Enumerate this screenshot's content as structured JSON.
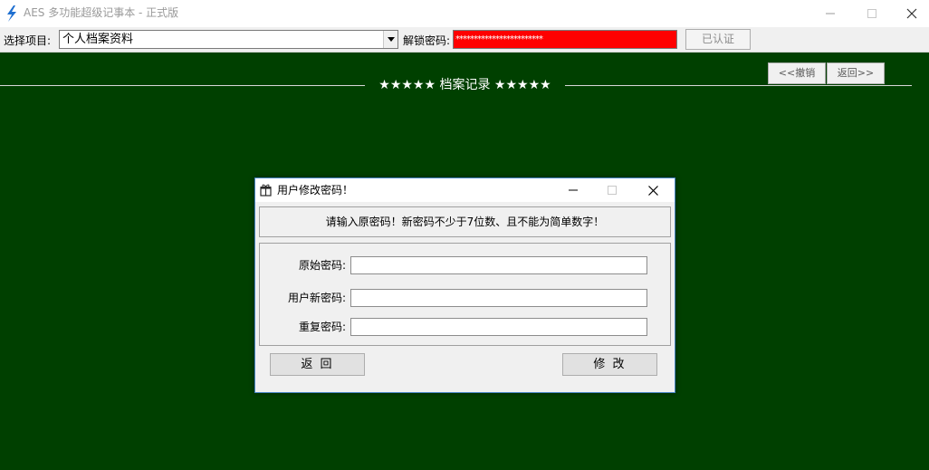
{
  "window": {
    "title": "AES 多功能超级记事本 - 正式版",
    "icon": "lightning-icon",
    "accent_color": "#1e6fd0"
  },
  "toolbar": {
    "select_label": "选择项目:",
    "select_value": "个人档案资料",
    "unlock_label": "解锁密码:",
    "password_mask": "************************",
    "password_field_color": "#ff0000",
    "verified_button": "已认证"
  },
  "content": {
    "background_color": "#004000",
    "undo_button": "<<撤销",
    "back_button": "返回>>",
    "section_title": "★★★★★  档案记录  ★★★★★"
  },
  "dialog": {
    "title": "用户修改密码！",
    "icon": "gift-icon",
    "notice": "请输入原密码！新密码不少于7位数、且不能为简单数字！",
    "fields": [
      {
        "label": "原始密码:",
        "value": ""
      },
      {
        "label": "用户新密码:",
        "value": ""
      },
      {
        "label": "重复密码:",
        "value": ""
      }
    ],
    "back_button": "返  回",
    "modify_button": "修  改"
  }
}
